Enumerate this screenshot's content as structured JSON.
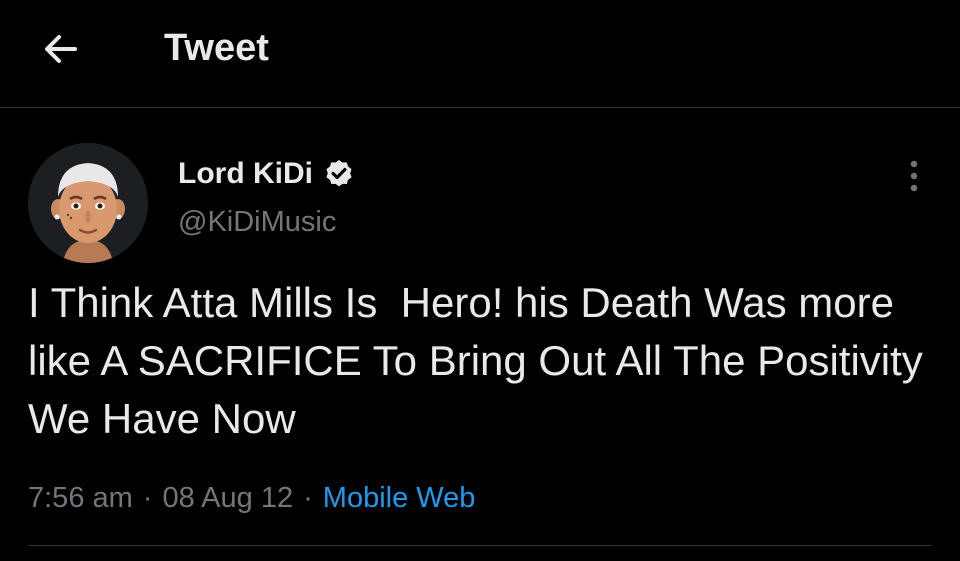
{
  "header": {
    "back_icon": "arrow-left-icon",
    "title": "Tweet"
  },
  "tweet": {
    "avatar_icon": "memoji-avatar",
    "display_name": "Lord KiDi",
    "verified_icon": "verified-badge-icon",
    "handle": "@KiDiMusic",
    "more_icon": "more-vertical-icon",
    "text": "I Think Atta Mills Is  Hero! his Death Was more like A SACRIFICE To Bring Out All The Positivity We Have Now",
    "time": "7:56 am",
    "separator": "·",
    "date": "08 Aug 12",
    "source": "Mobile Web"
  },
  "colors": {
    "background": "#000000",
    "text": "#e7e9ea",
    "muted": "#71767b",
    "link": "#1d9bf0",
    "divider": "#2f3336"
  }
}
